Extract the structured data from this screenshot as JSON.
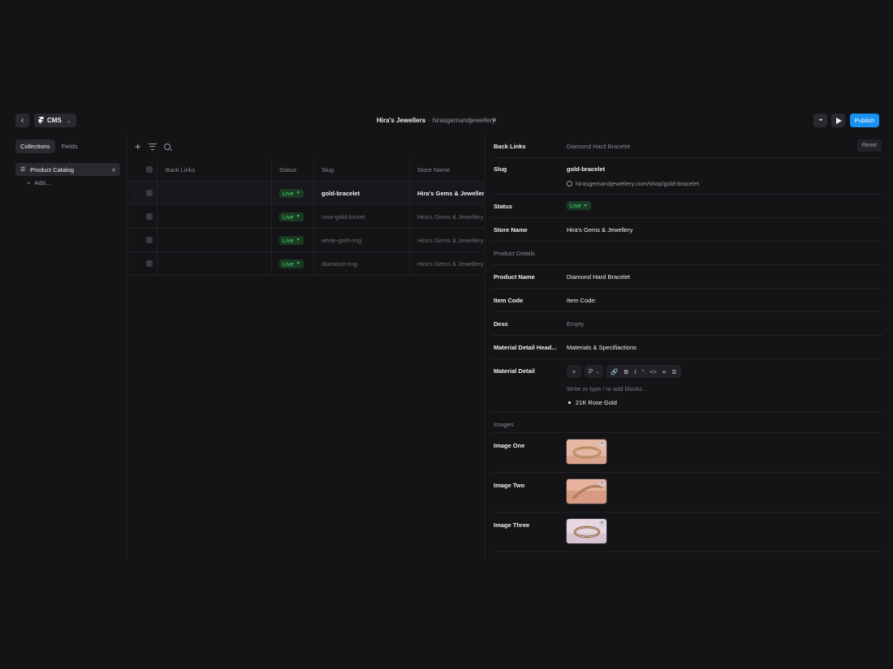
{
  "topbar": {
    "cms_label": "CMS",
    "site_name": "Hira's Jewellers",
    "site_sep": "·",
    "site_domain": "hirasgemandjewellery",
    "close_glyph": "×",
    "more_glyph": "•••",
    "publish_label": "Publish"
  },
  "sidebar": {
    "tabs": [
      {
        "label": "Collections",
        "active": true
      },
      {
        "label": "Fields",
        "active": false
      }
    ],
    "collection": {
      "name": "Product Catalog",
      "count": "4"
    },
    "add_label": "Add..."
  },
  "table": {
    "columns": {
      "back_links": "Back Links",
      "status": "Status",
      "slug": "Slug",
      "store_name": "Store Name"
    },
    "rows": [
      {
        "status": "Live",
        "slug": "gold-bracelet",
        "store": "Hira's Gems & Jewellery",
        "selected": true
      },
      {
        "status": "Live",
        "slug": "rose-gold-locket",
        "store": "Hira's Gems & Jewellery",
        "selected": false
      },
      {
        "status": "Live",
        "slug": "white-gold-ring",
        "store": "Hira's Gems & Jewellery",
        "selected": false
      },
      {
        "status": "Live",
        "slug": "diamond-ring",
        "store": "Hira's Gems & Jewellery",
        "selected": false
      }
    ]
  },
  "editor": {
    "back_links": {
      "label": "Back Links",
      "value": "Diamond Hard Bracelet",
      "reset": "Reset"
    },
    "slug": {
      "label": "Slug",
      "value": "gold-bracelet",
      "url": "hirasgemandjewellery.com/shop/gold-bracelet"
    },
    "status": {
      "label": "Status",
      "value": "Live"
    },
    "store_name": {
      "label": "Store Name",
      "value": "Hira's Gems & Jewellery"
    },
    "product_details_section": "Product Details",
    "product_name": {
      "label": "Product Name",
      "value": "Diamond Hard Bracelet"
    },
    "item_code": {
      "label": "Item Code",
      "value": "Item Code:"
    },
    "desc": {
      "label": "Desc",
      "value": "Empty"
    },
    "material_detail_heading": {
      "label": "Material Detail Head...",
      "value": "Materials & Specifiactions"
    },
    "material_detail": {
      "label": "Material Detail",
      "toolbar": {
        "add": "+",
        "paragraph": "P",
        "bold": "B",
        "italic": "I",
        "quote": "“",
        "code": "<>"
      },
      "placeholder": "Write or type / to add blocks...",
      "bullet": "21K Rose Gold"
    },
    "images_section": "Images",
    "images": [
      {
        "label": "Image One"
      },
      {
        "label": "Image Two"
      },
      {
        "label": "Image Three"
      }
    ]
  },
  "colors": {
    "accent": "#1791f2",
    "live_green": "#3ddc6d",
    "background": "#141316"
  }
}
